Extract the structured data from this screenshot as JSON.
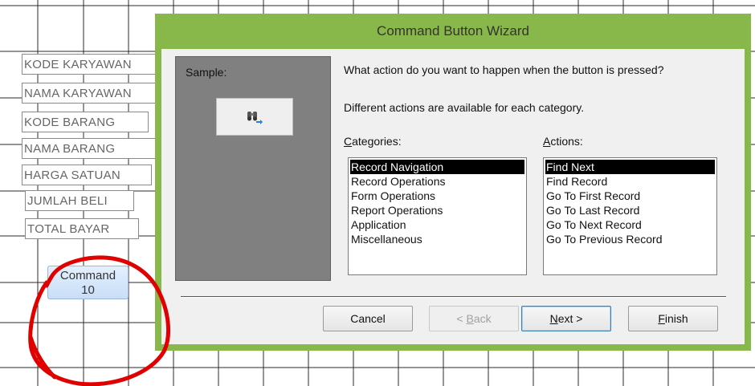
{
  "form_fields": [
    "KODE KARYAWAN",
    "NAMA KARYAWAN",
    "KODE BARANG",
    "NAMA BARANG",
    "HARGA SATUAN",
    "JUMLAH BELI",
    "TOTAL BAYAR"
  ],
  "command_button": {
    "line1": "Command",
    "line2": "10"
  },
  "wizard": {
    "title": "Command Button Wizard",
    "sample_label": "Sample:",
    "sample_icon": "binoculars-find-next-icon",
    "question": "What action do you want to happen when the button is pressed?",
    "info": "Different actions are available for each category.",
    "categories_label": {
      "mnemonic": "C",
      "rest": "ategories:"
    },
    "actions_label": {
      "mnemonic": "A",
      "rest": "ctions:"
    },
    "categories": [
      "Record Navigation",
      "Record Operations",
      "Form Operations",
      "Report Operations",
      "Application",
      "Miscellaneous"
    ],
    "selected_category": "Record Navigation",
    "actions": [
      "Find Next",
      "Find Record",
      "Go To First Record",
      "Go To Last Record",
      "Go To Next Record",
      "Go To Previous Record"
    ],
    "selected_action": "Find Next",
    "buttons": {
      "cancel": "Cancel",
      "back": {
        "pre": "< ",
        "mnemonic": "B",
        "rest": "ack"
      },
      "next": {
        "mnemonic": "N",
        "rest": "ext >"
      },
      "finish": {
        "mnemonic": "F",
        "rest": "inish"
      }
    }
  },
  "colors": {
    "wizard_frame": "#89b84a",
    "selection": "#000000",
    "annotation": "#e00000"
  }
}
